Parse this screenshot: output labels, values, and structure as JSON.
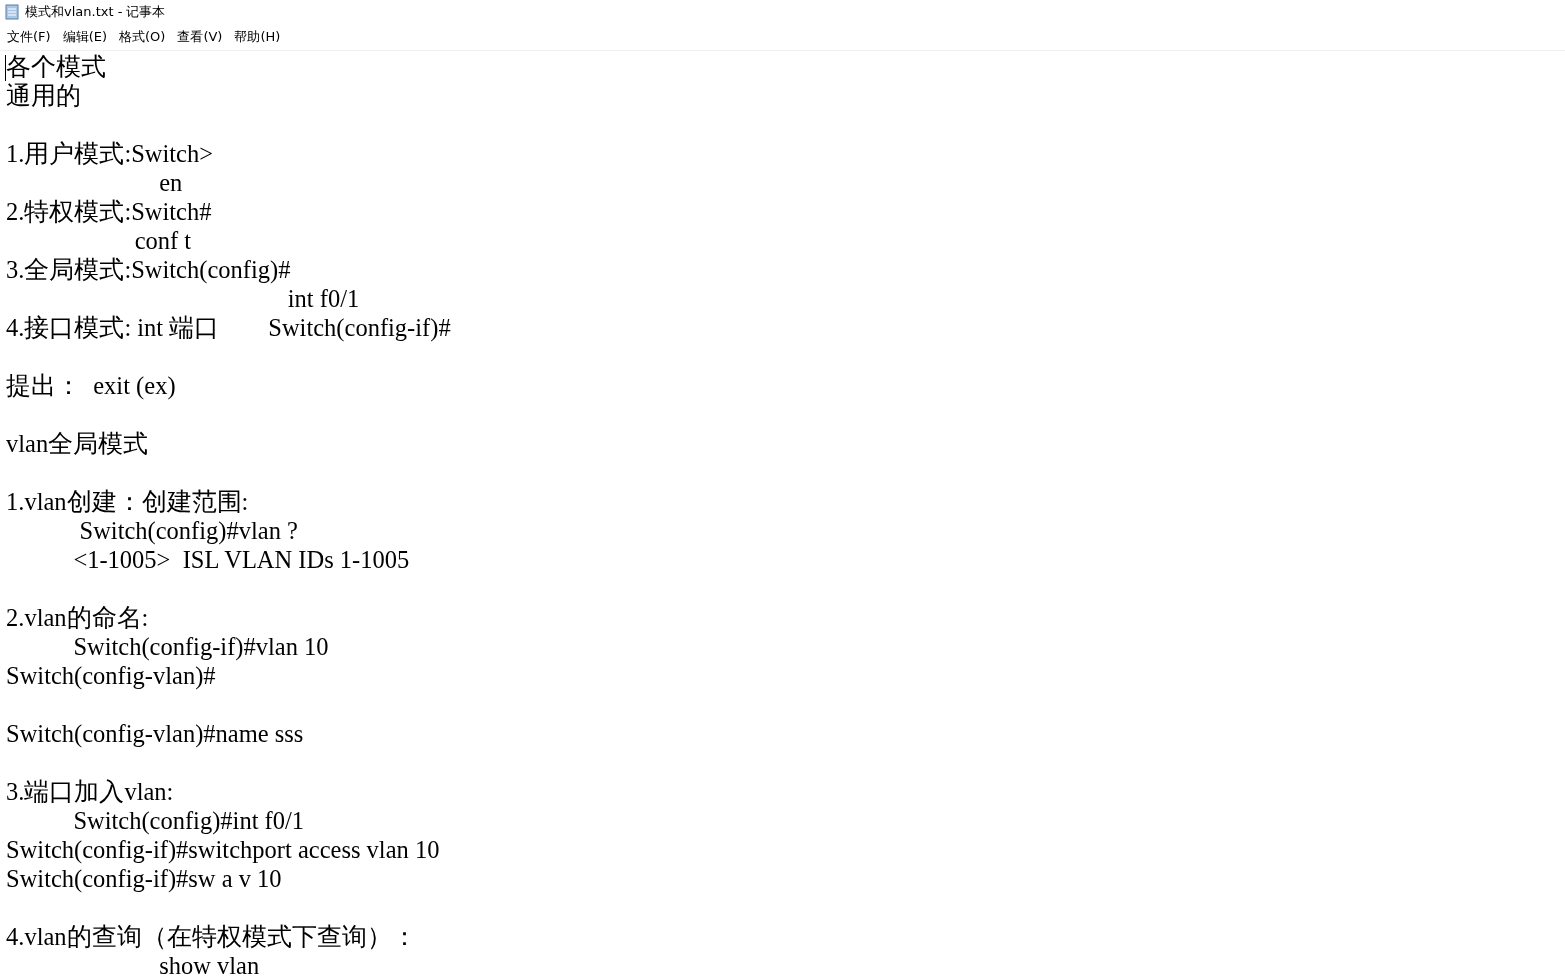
{
  "window": {
    "title": "模式和vlan.txt - 记事本"
  },
  "menu": [
    {
      "label": "文件(F)"
    },
    {
      "label": "编辑(E)"
    },
    {
      "label": "格式(O)"
    },
    {
      "label": "查看(V)"
    },
    {
      "label": "帮助(H)"
    }
  ],
  "document": {
    "lines": [
      {
        "kind": "text",
        "text": "各个模式"
      },
      {
        "kind": "text",
        "text": "通用的"
      },
      {
        "kind": "blank"
      },
      {
        "kind": "text",
        "text": "1.用户模式:Switch>"
      },
      {
        "kind": "text",
        "text": "                         en"
      },
      {
        "kind": "text",
        "text": "2.特权模式:Switch#"
      },
      {
        "kind": "text",
        "text": "                     conf t"
      },
      {
        "kind": "text",
        "text": "3.全局模式:Switch(config)#"
      },
      {
        "kind": "text",
        "text": "                                              int f0/1"
      },
      {
        "kind": "text",
        "text": "4.接口模式: int 端口        Switch(config-if)#"
      },
      {
        "kind": "blank"
      },
      {
        "kind": "text",
        "text": "提出：  exit (ex)"
      },
      {
        "kind": "blank"
      },
      {
        "kind": "text",
        "text": "vlan全局模式"
      },
      {
        "kind": "blank"
      },
      {
        "kind": "text",
        "text": "1.vlan创建：创建范围:"
      },
      {
        "kind": "text",
        "text": "            Switch(config)#vlan ?"
      },
      {
        "kind": "text",
        "text": "           <1-1005>  ISL VLAN IDs 1-1005"
      },
      {
        "kind": "blank"
      },
      {
        "kind": "text",
        "text": "2.vlan的命名:"
      },
      {
        "kind": "text",
        "text": "           Switch(config-if)#vlan 10"
      },
      {
        "kind": "text",
        "text": "Switch(config-vlan)#"
      },
      {
        "kind": "blank"
      },
      {
        "kind": "text",
        "text": "Switch(config-vlan)#name sss"
      },
      {
        "kind": "blank"
      },
      {
        "kind": "text",
        "text": "3.端口加入vlan:"
      },
      {
        "kind": "text",
        "text": "           Switch(config)#int f0/1"
      },
      {
        "kind": "text",
        "text": "Switch(config-if)#switchport access vlan 10"
      },
      {
        "kind": "text",
        "text": "Switch(config-if)#sw a v 10"
      },
      {
        "kind": "blank"
      },
      {
        "kind": "text",
        "text": "4.vlan的查询（在特权模式下查询）："
      },
      {
        "kind": "text",
        "text": "                         show vlan"
      }
    ]
  }
}
